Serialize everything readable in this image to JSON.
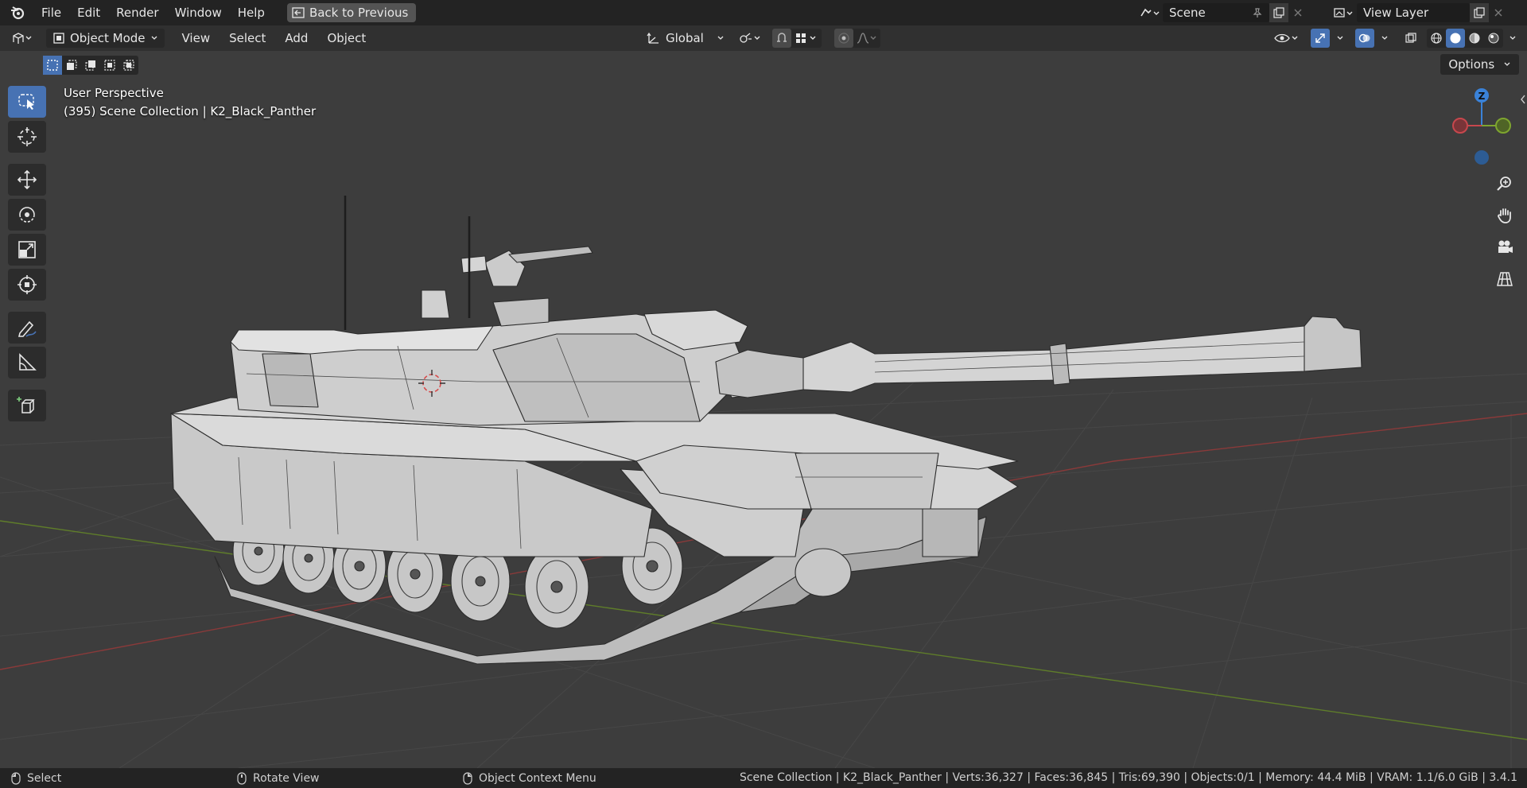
{
  "topbar": {
    "menus": [
      "File",
      "Edit",
      "Render",
      "Window",
      "Help"
    ],
    "back_button": "Back to Previous",
    "scene_name": "Scene",
    "view_layer": "View Layer"
  },
  "header": {
    "mode": "Object Mode",
    "menus": [
      "View",
      "Select",
      "Add",
      "Object"
    ],
    "transform_orientation": "Global"
  },
  "toolsettings": {
    "options_label": "Options"
  },
  "viewport": {
    "perspective": "User Perspective",
    "collection_line": "(395) Scene Collection | K2_Black_Panther",
    "gizmo_axes": {
      "z": "Z"
    }
  },
  "statusbar": {
    "hints": [
      "Select",
      "Rotate View",
      "Object Context Menu"
    ],
    "stats": "Scene Collection | K2_Black_Panther | Verts:36,327 | Faces:36,845 | Tris:69,390 | Objects:0/1 | Memory: 44.4 MiB | VRAM: 1.1/6.0 GiB | 3.4.1"
  },
  "colors": {
    "accent": "#4772b3",
    "axis_x": "#c7474d",
    "axis_y": "#7ea52f",
    "axis_z": "#3a82d8"
  }
}
